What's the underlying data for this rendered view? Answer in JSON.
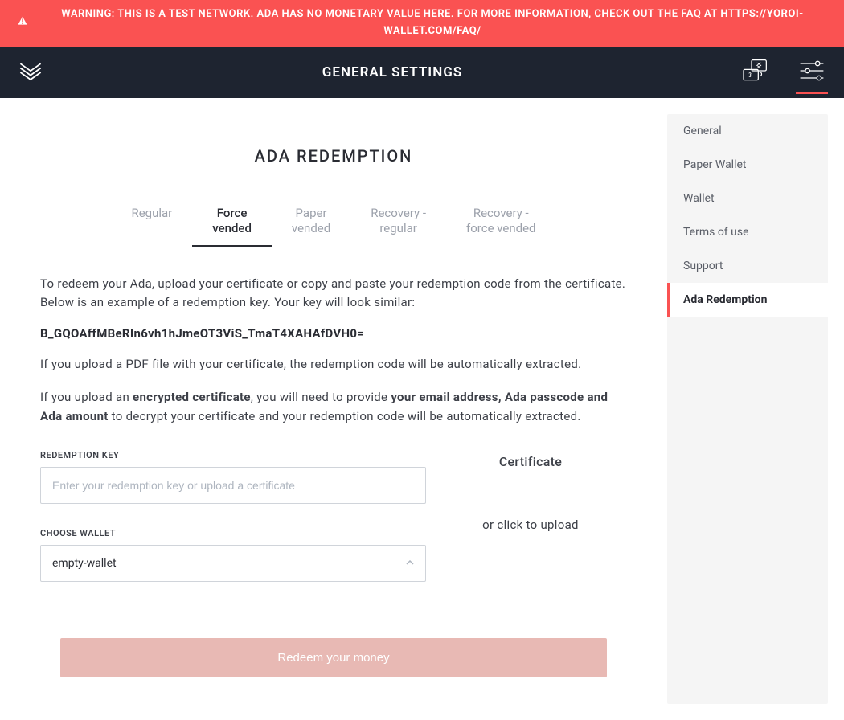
{
  "warning": {
    "text": "WARNING: THIS IS A TEST NETWORK. ADA HAS NO MONETARY VALUE HERE. FOR MORE INFORMATION, CHECK OUT THE FAQ AT ",
    "link_text": "HTTPS://YOROI-WALLET.COM/FAQ/"
  },
  "header": {
    "title": "GENERAL SETTINGS"
  },
  "main": {
    "title": "ADA REDEMPTION",
    "tabs": [
      {
        "label": "Regular",
        "active": false
      },
      {
        "label": "Force vended",
        "active": true
      },
      {
        "label": "Paper vended",
        "active": false
      },
      {
        "label": "Recovery - regular",
        "active": false
      },
      {
        "label": "Recovery - force vended",
        "active": false
      }
    ],
    "instructions": {
      "p1": "To redeem your Ada, upload your certificate or copy and paste your redemption code from the certificate. Below is an example of a redemption key. Your key will look similar:",
      "example_key": "B_GQOAffMBeRIn6vh1hJmeOT3ViS_TmaT4XAHAfDVH0=",
      "p2": "If you upload a PDF file with your certificate, the redemption code will be automatically extracted.",
      "p3_prefix": "If you upload an ",
      "p3_strong1": "encrypted certificate",
      "p3_mid": ", you will need to provide ",
      "p3_strong2": "your email address, Ada passcode and Ada amount",
      "p3_suffix": " to decrypt your certificate and your redemption code will be automatically extracted."
    },
    "form": {
      "redemption_key_label": "REDEMPTION KEY",
      "redemption_key_placeholder": "Enter your redemption key or upload a certificate",
      "redemption_key_value": "",
      "choose_wallet_label": "CHOOSE WALLET",
      "choose_wallet_value": "empty-wallet",
      "certificate_title": "Certificate",
      "certificate_upload": "or click to upload",
      "redeem_button": "Redeem your money"
    }
  },
  "sidebar": {
    "items": [
      {
        "label": "General",
        "active": false
      },
      {
        "label": "Paper Wallet",
        "active": false
      },
      {
        "label": "Wallet",
        "active": false
      },
      {
        "label": "Terms of use",
        "active": false
      },
      {
        "label": "Support",
        "active": false
      },
      {
        "label": "Ada Redemption",
        "active": true
      }
    ]
  }
}
